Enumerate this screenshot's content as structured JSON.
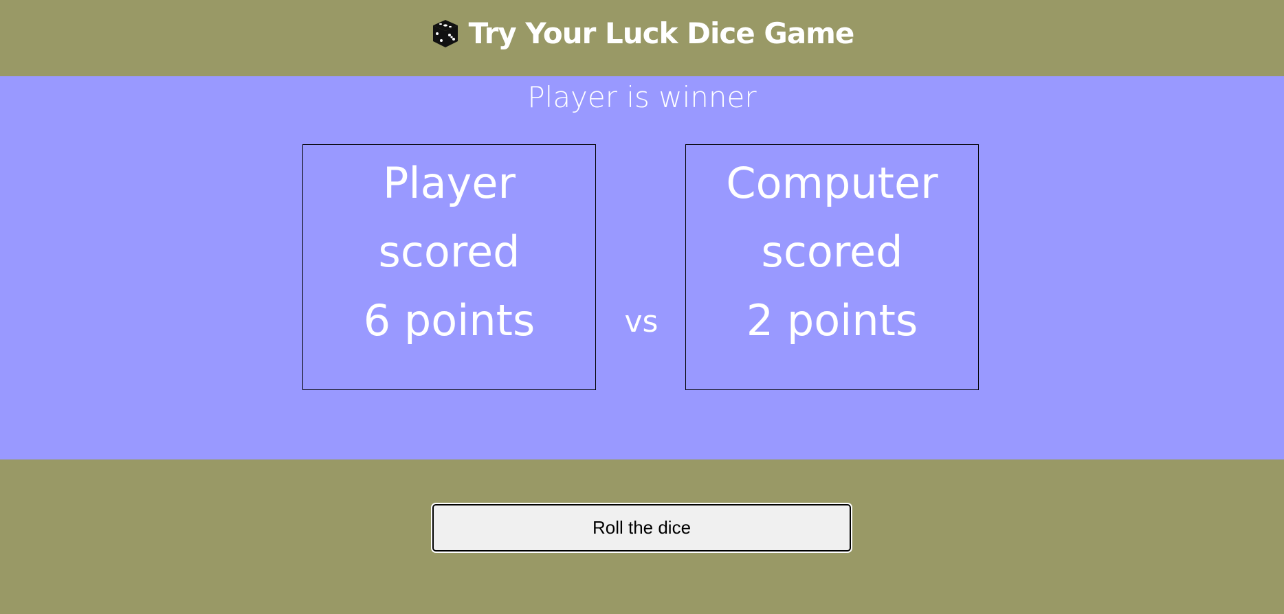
{
  "header": {
    "icon": "dice-icon",
    "title": "Try Your Luck Dice Game"
  },
  "result": {
    "text": "Player is winner"
  },
  "player": {
    "name": "Player",
    "scored_label": "scored",
    "points_text": "6 points",
    "score": 6
  },
  "versus": {
    "label": "vs"
  },
  "computer": {
    "name": "Computer",
    "scored_label": "scored",
    "points_text": "2 points",
    "score": 2
  },
  "controls": {
    "roll_label": "Roll the dice"
  },
  "colors": {
    "header_bg": "#999966",
    "main_bg": "#9999ff",
    "text": "#ffffff"
  }
}
